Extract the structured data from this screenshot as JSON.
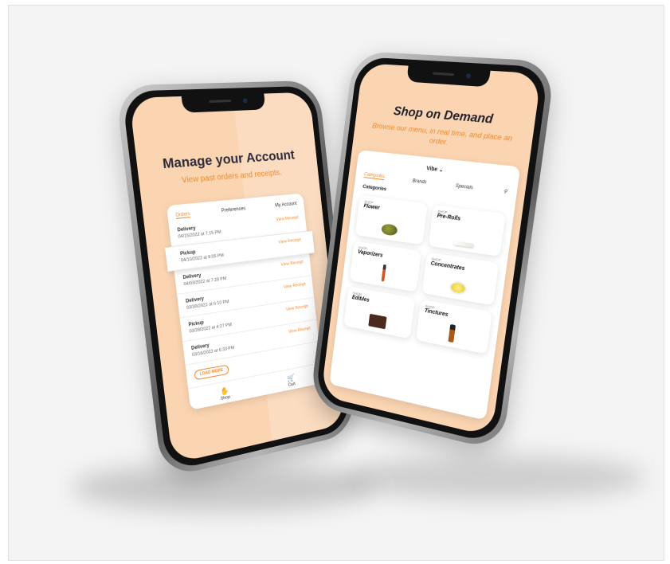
{
  "left_phone": {
    "title": "Manage your Account",
    "subtitle": "View past orders and receipts.",
    "tabs": [
      "Orders",
      "Preferences",
      "My Account"
    ],
    "orders": [
      {
        "type": "Delivery",
        "date": "04/15/2022 at 7:15 PM",
        "link": "View Receipt"
      },
      {
        "type": "Pickup",
        "date": "04/10/2022 at 8:05 PM",
        "link": "View Receipt"
      },
      {
        "type": "Delivery",
        "date": "04/03/2022 at 7:28 PM",
        "link": "View Receipt"
      },
      {
        "type": "Delivery",
        "date": "03/30/2022 at 6:10 PM",
        "link": "View Receipt"
      },
      {
        "type": "Pickup",
        "date": "03/28/2022 at 4:27 PM",
        "link": "View Receipt"
      },
      {
        "type": "Delivery",
        "date": "03/16/2022 at 6:33 PM",
        "link": "View Receipt"
      }
    ],
    "load_more": "LOAD MORE",
    "nav": {
      "shop": "Shop",
      "cart": "Cart"
    }
  },
  "right_phone": {
    "title": "Shop on Demand",
    "subtitle": "Browse our menu, in real time, and place an order.",
    "store": "Vibe",
    "tabs": [
      "Categories",
      "Brands",
      "Specials"
    ],
    "section_title": "Categories",
    "categories": [
      {
        "prefix": "SHOP",
        "name": "Flower"
      },
      {
        "prefix": "SHOP",
        "name": "Pre-Rolls"
      },
      {
        "prefix": "SHOP",
        "name": "Vaporizers"
      },
      {
        "prefix": "SHOP",
        "name": "Concentrates"
      },
      {
        "prefix": "SHOP",
        "name": "Edibles"
      },
      {
        "prefix": "SHOP",
        "name": "Tinctures"
      }
    ]
  },
  "colors": {
    "accent": "#f08a2a",
    "screen_bg": "#fbd5b2",
    "page_bg": "#f4f4f4"
  },
  "icons": [
    "search-icon",
    "chevron-down-icon",
    "shop-icon",
    "cart-icon"
  ]
}
